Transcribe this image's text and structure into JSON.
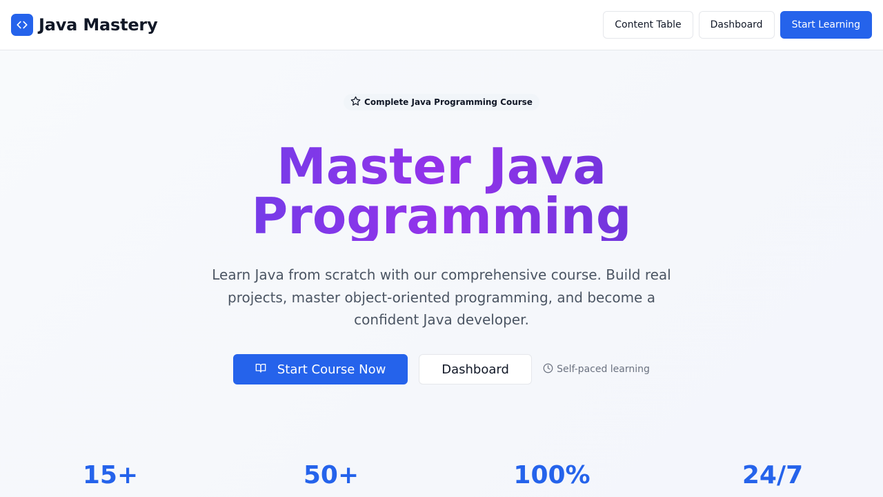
{
  "header": {
    "brand_name": "Java Mastery",
    "brand_icon": "code-icon",
    "nav": {
      "content_table": "Content Table",
      "dashboard": "Dashboard",
      "start_learning": "Start Learning"
    }
  },
  "hero": {
    "badge_icon": "star-icon",
    "badge": "Complete Java Programming Course",
    "title_line1": "Master Java",
    "title_line2": "Programming",
    "subtitle": "Learn Java from scratch with our comprehensive course. Build real projects, master object-oriented programming, and become a confident Java developer.",
    "cta_primary": "Start Course Now",
    "cta_primary_icon": "book-open-icon",
    "cta_secondary": "Dashboard",
    "self_paced_icon": "clock-icon",
    "self_paced": "Self-paced learning"
  },
  "stats": [
    {
      "value": "15+"
    },
    {
      "value": "50+"
    },
    {
      "value": "100%"
    },
    {
      "value": "24/7"
    }
  ],
  "colors": {
    "primary": "#2563eb",
    "gradient_start": "#4f46e5",
    "gradient_mid": "#9333ea",
    "gradient_end": "#4338ca",
    "muted_text": "#4b5563"
  }
}
